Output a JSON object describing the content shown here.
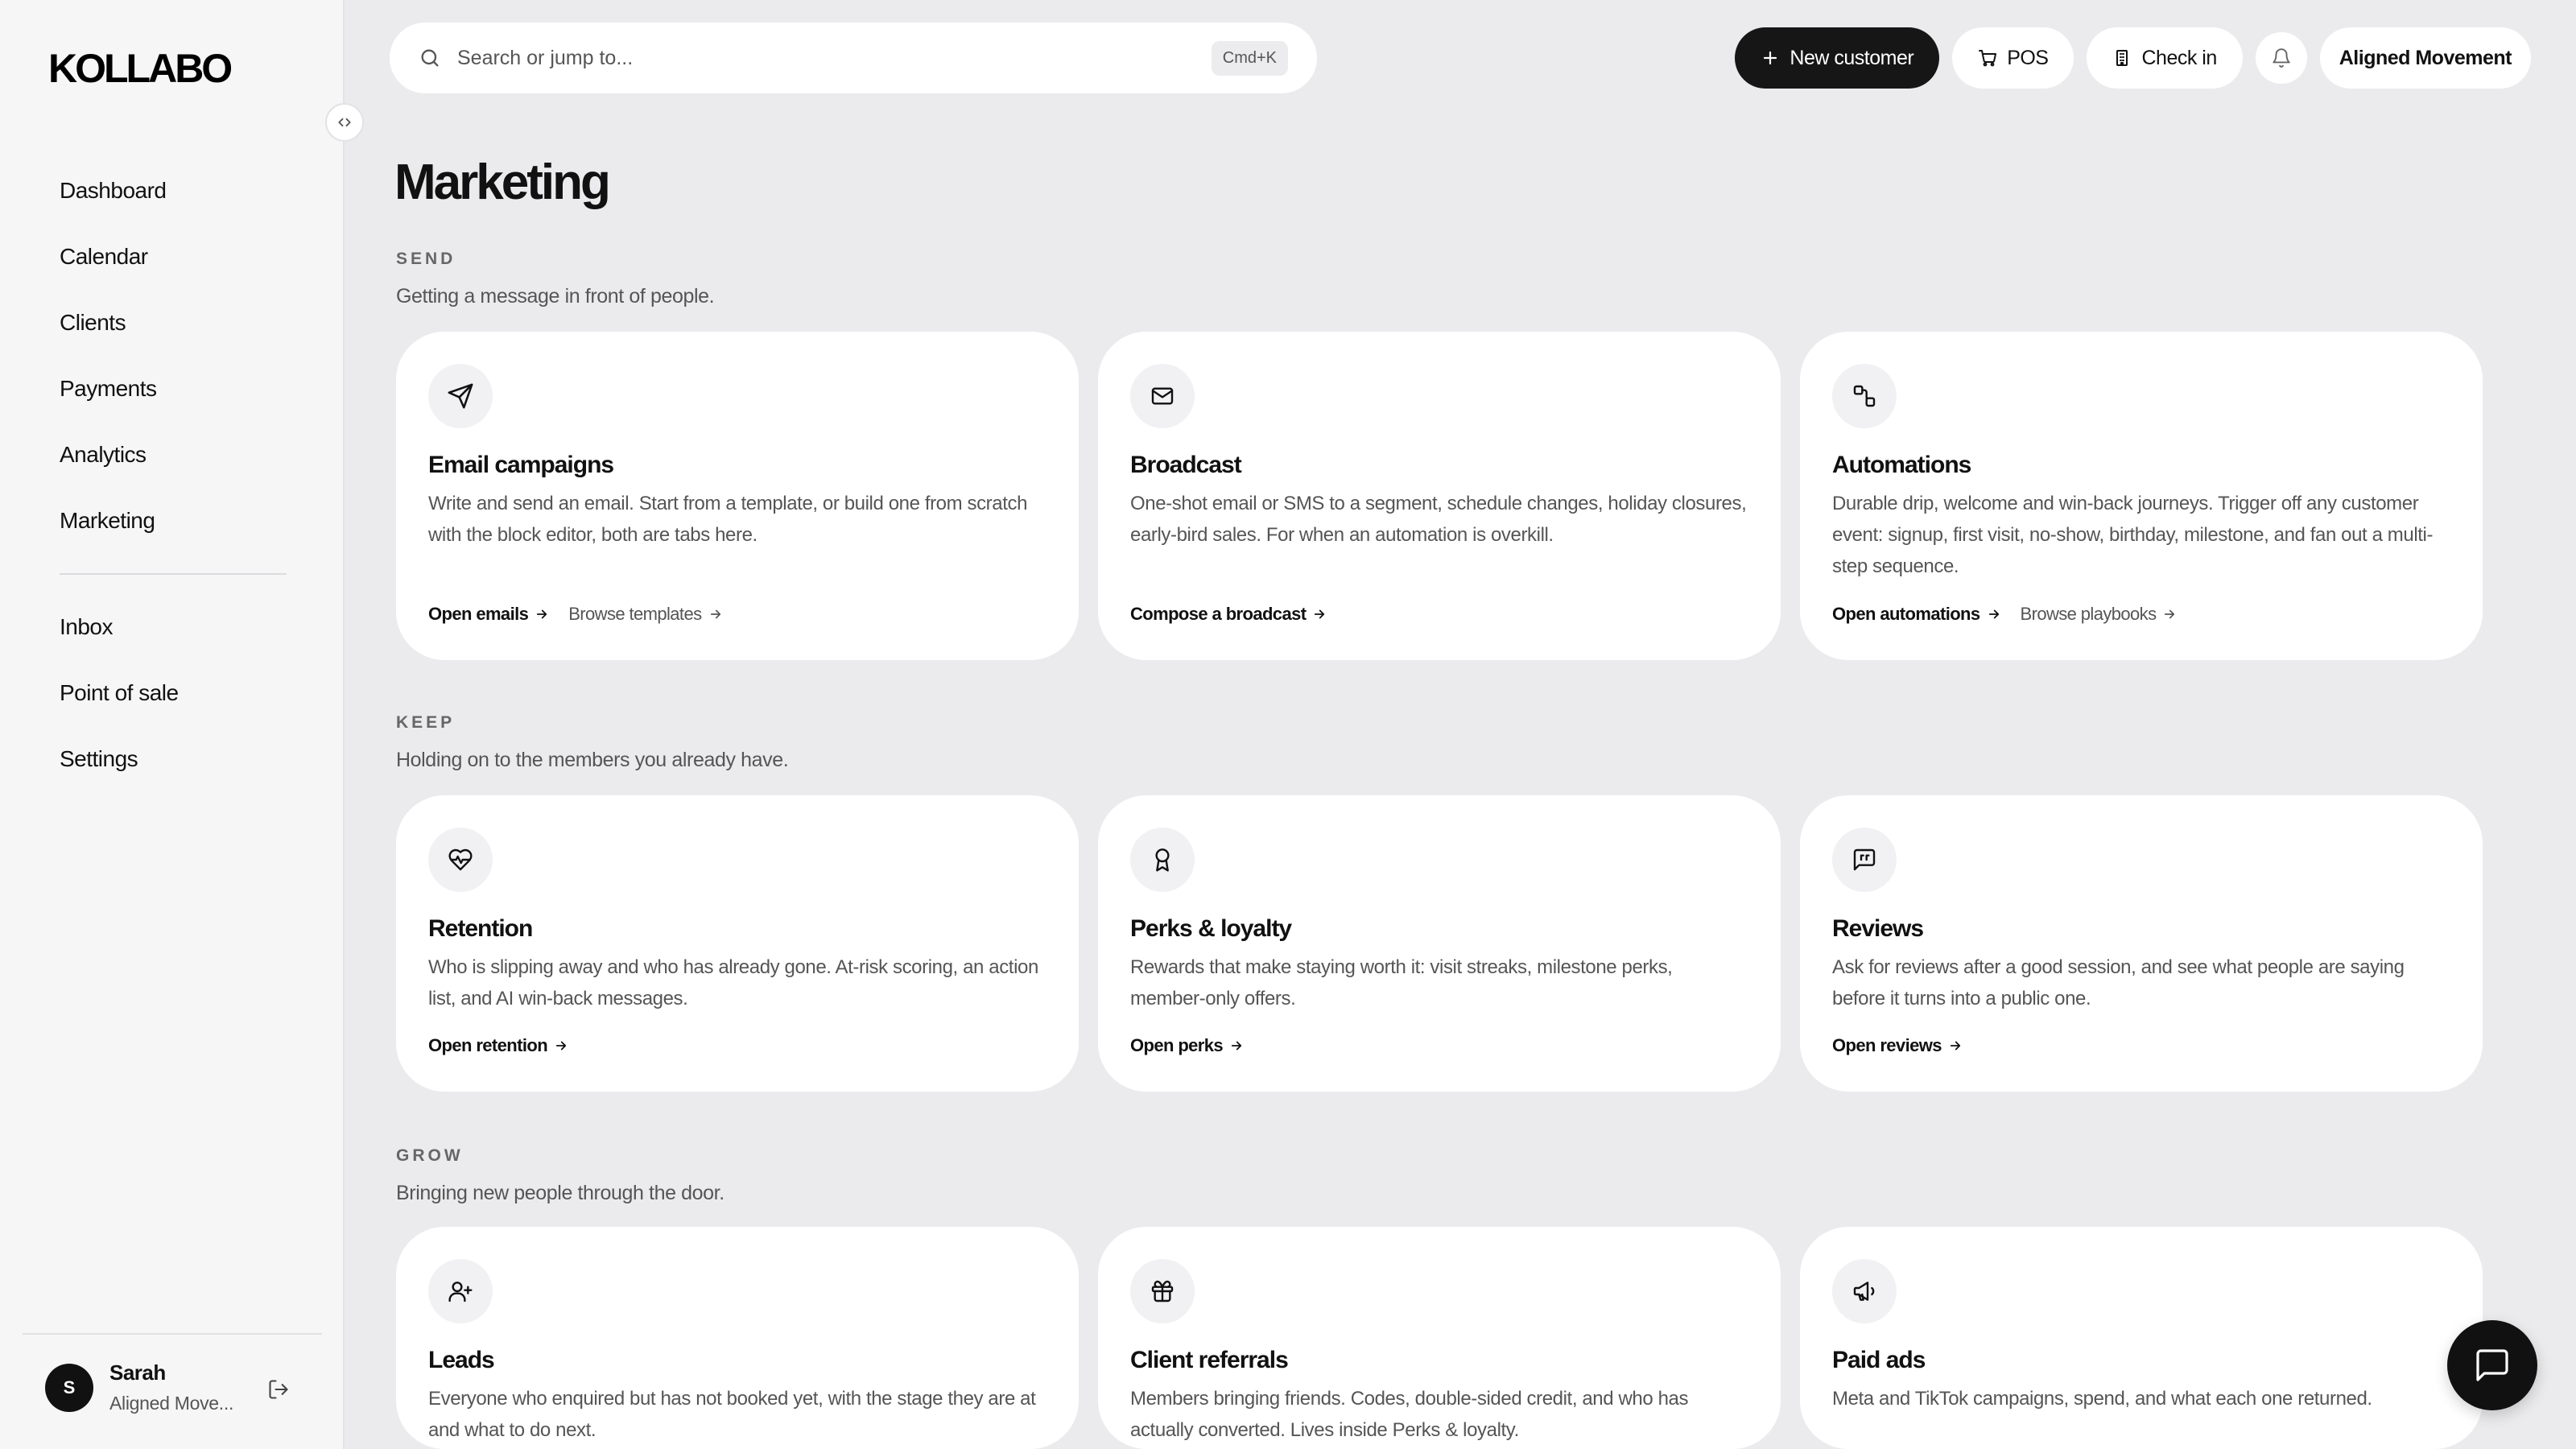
{
  "app": {
    "logo": "KOLLABO"
  },
  "sidebar": {
    "items": [
      {
        "label": "Dashboard"
      },
      {
        "label": "Calendar"
      },
      {
        "label": "Clients"
      },
      {
        "label": "Payments"
      },
      {
        "label": "Analytics"
      },
      {
        "label": "Marketing"
      }
    ],
    "items_secondary": [
      {
        "label": "Inbox"
      },
      {
        "label": "Point of sale"
      },
      {
        "label": "Settings"
      }
    ],
    "user": {
      "initial": "S",
      "name": "Sarah",
      "org": "Aligned Move..."
    }
  },
  "topbar": {
    "search_placeholder": "Search or jump to...",
    "shortcut": "Cmd+K",
    "new_customer": "New customer",
    "pos": "POS",
    "check_in": "Check in",
    "workspace": "Aligned Movement"
  },
  "page": {
    "title": "Marketing"
  },
  "sections": [
    {
      "label": "SEND",
      "description": "Getting a message in front of people.",
      "cards": [
        {
          "title": "Email campaigns",
          "icon": "send-icon",
          "description": "Write and send an email. Start from a template, or build one from scratch with the block editor, both are tabs here.",
          "primary_link": "Open emails",
          "secondary_link": "Browse templates"
        },
        {
          "title": "Broadcast",
          "icon": "mail-icon",
          "description": "One-shot email or SMS to a segment, schedule changes, holiday closures, early-bird sales. For when an automation is overkill.",
          "primary_link": "Compose a broadcast"
        },
        {
          "title": "Automations",
          "icon": "workflow-icon",
          "description": "Durable drip, welcome and win-back journeys. Trigger off any customer event: signup, first visit, no-show, birthday, milestone, and fan out a multi-step sequence.",
          "primary_link": "Open automations",
          "secondary_link": "Browse playbooks"
        }
      ]
    },
    {
      "label": "KEEP",
      "description": "Holding on to the members you already have.",
      "cards": [
        {
          "title": "Retention",
          "icon": "heart-pulse-icon",
          "description": "Who is slipping away and who has already gone. At-risk scoring, an action list, and AI win-back messages.",
          "primary_link": "Open retention"
        },
        {
          "title": "Perks & loyalty",
          "icon": "award-icon",
          "description": "Rewards that make staying worth it: visit streaks, milestone perks, member-only offers.",
          "primary_link": "Open perks"
        },
        {
          "title": "Reviews",
          "icon": "message-quote-icon",
          "description": "Ask for reviews after a good session, and see what people are saying before it turns into a public one.",
          "primary_link": "Open reviews"
        }
      ]
    },
    {
      "label": "GROW",
      "description": "Bringing new people through the door.",
      "cards": [
        {
          "title": "Leads",
          "icon": "user-plus-icon",
          "description": "Everyone who enquired but has not booked yet, with the stage they are at and what to do next."
        },
        {
          "title": "Client referrals",
          "icon": "gift-icon",
          "description": "Members bringing friends. Codes, double-sided credit, and who has actually converted. Lives inside Perks & loyalty."
        },
        {
          "title": "Paid ads",
          "icon": "megaphone-icon",
          "description": "Meta and TikTok campaigns, spend, and what each one returned."
        }
      ]
    }
  ]
}
